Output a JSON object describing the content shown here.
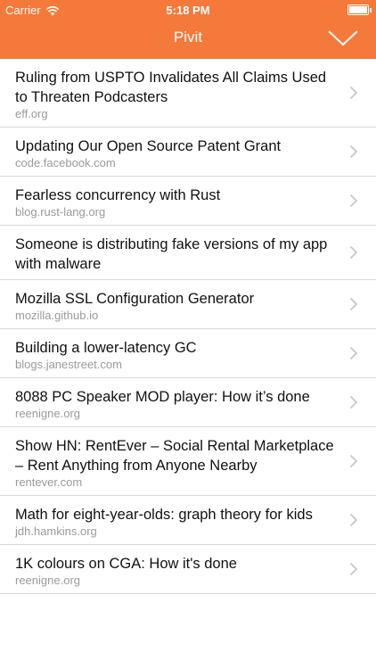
{
  "status_bar": {
    "carrier": "Carrier",
    "time": "5:18 PM",
    "battery_level": 1.0
  },
  "header": {
    "title": "Pivit",
    "accent_color": "#f5793a"
  },
  "items": [
    {
      "title": "Ruling from USPTO Invalidates All Claims Used to Threaten Podcasters",
      "domain": "eff.org"
    },
    {
      "title": "Updating Our Open Source Patent Grant",
      "domain": "code.facebook.com"
    },
    {
      "title": "Fearless concurrency with Rust",
      "domain": "blog.rust-lang.org"
    },
    {
      "title": "Someone is distributing fake versions of my app with malware",
      "domain": ""
    },
    {
      "title": "Mozilla SSL Configuration Generator",
      "domain": "mozilla.github.io"
    },
    {
      "title": "Building a lower-latency GC",
      "domain": "blogs.janestreet.com"
    },
    {
      "title": "8088 PC Speaker MOD player: How it’s done",
      "domain": "reenigne.org"
    },
    {
      "title": "Show HN: RentEver – Social Rental Marketplace – Rent Anything from Anyone Nearby",
      "domain": "rentever.com"
    },
    {
      "title": "Math for eight-year-olds: graph theory for kids",
      "domain": "jdh.hamkins.org"
    },
    {
      "title": "1K colours on CGA: How it's done",
      "domain": "reenigne.org"
    }
  ]
}
